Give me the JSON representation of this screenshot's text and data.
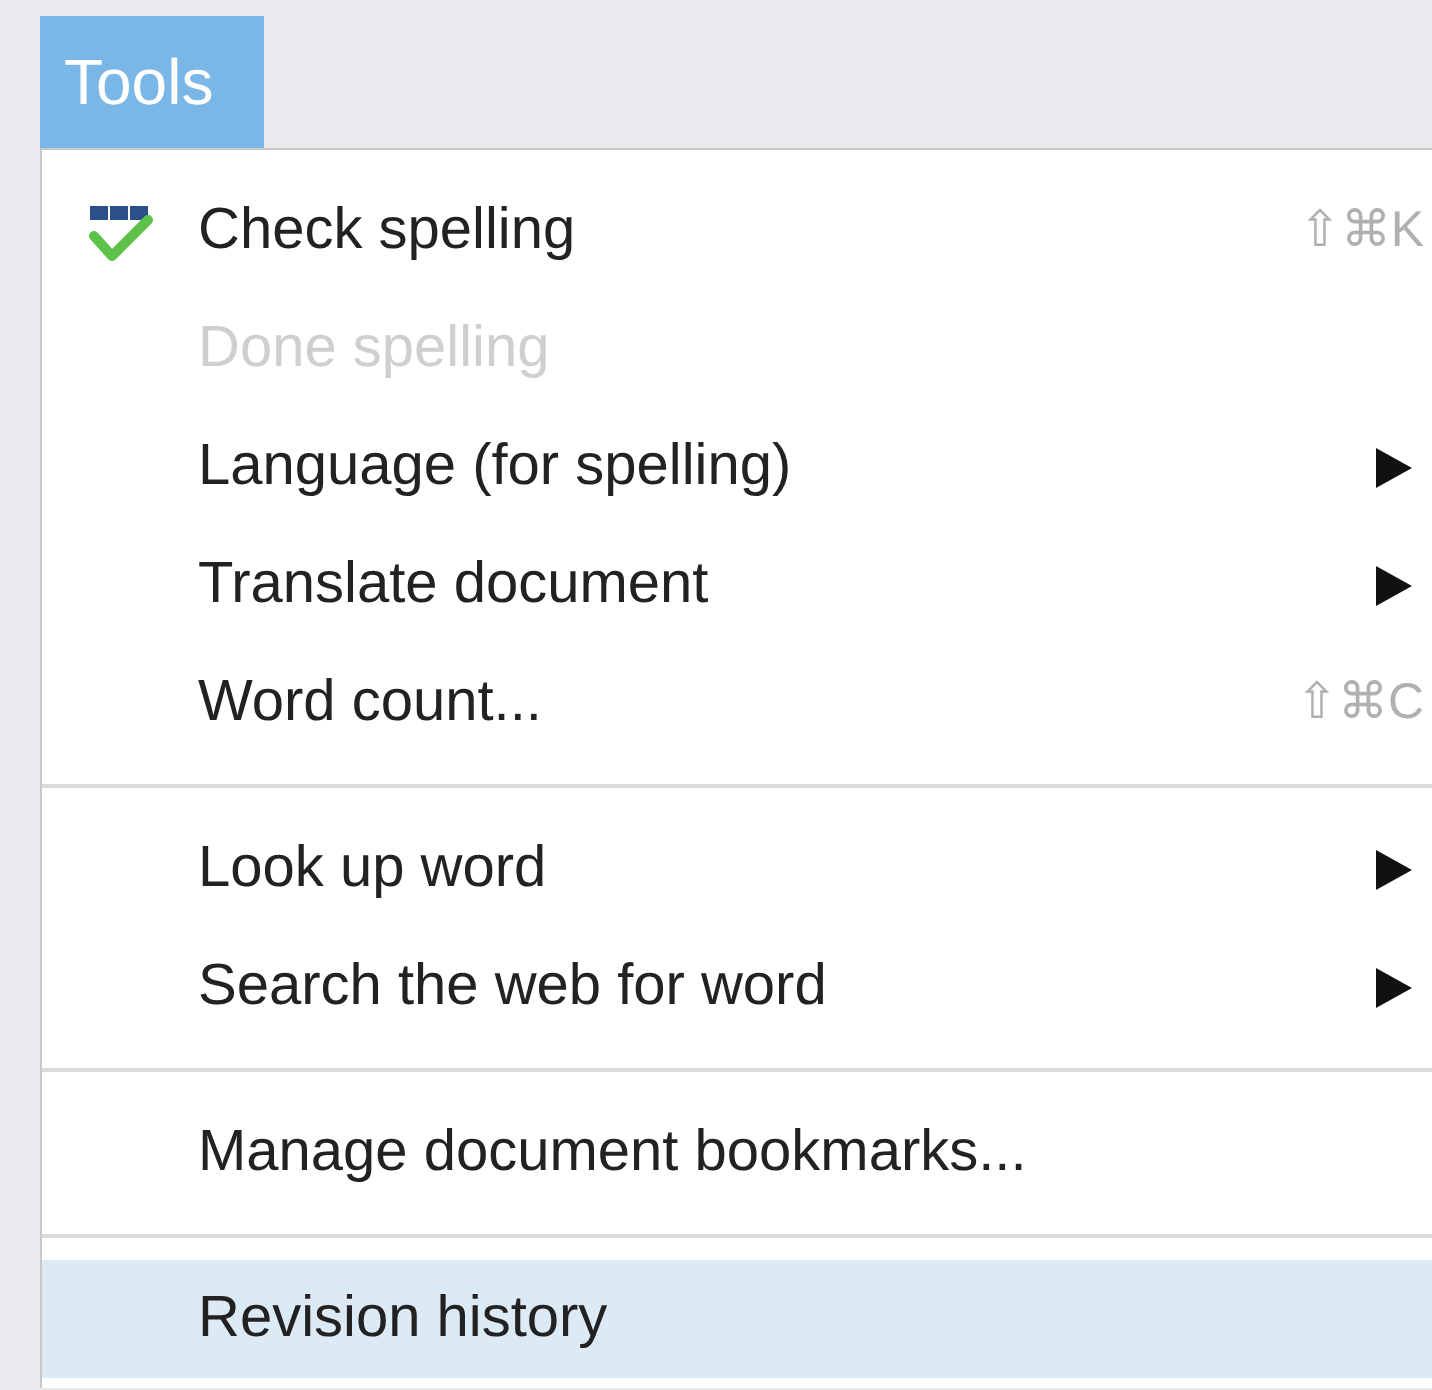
{
  "menu_bar": {
    "title": "Tools",
    "selected": true
  },
  "sections": [
    {
      "items": [
        {
          "label": "Check spelling",
          "kind": "spelling",
          "shortcut": "⇧⌘K",
          "disabled": false,
          "selected": false,
          "submenu": false
        },
        {
          "label": "Done spelling",
          "disabled": true,
          "selected": false,
          "submenu": false
        },
        {
          "label": "Language (for spelling)",
          "disabled": false,
          "selected": false,
          "submenu": true
        },
        {
          "label": "Translate document",
          "disabled": false,
          "selected": false,
          "submenu": true
        },
        {
          "label": "Word count...",
          "shortcut": "⇧⌘C",
          "disabled": false,
          "selected": false,
          "submenu": false
        }
      ]
    },
    {
      "items": [
        {
          "label": "Look up word",
          "disabled": false,
          "selected": false,
          "submenu": true
        },
        {
          "label": "Search the web for word",
          "disabled": false,
          "selected": false,
          "submenu": true
        }
      ]
    },
    {
      "items": [
        {
          "label": "Manage document bookmarks...",
          "disabled": false,
          "selected": false,
          "submenu": false
        }
      ]
    },
    {
      "items": [
        {
          "label": "Revision history",
          "disabled": false,
          "selected": true,
          "submenu": false
        }
      ]
    }
  ]
}
